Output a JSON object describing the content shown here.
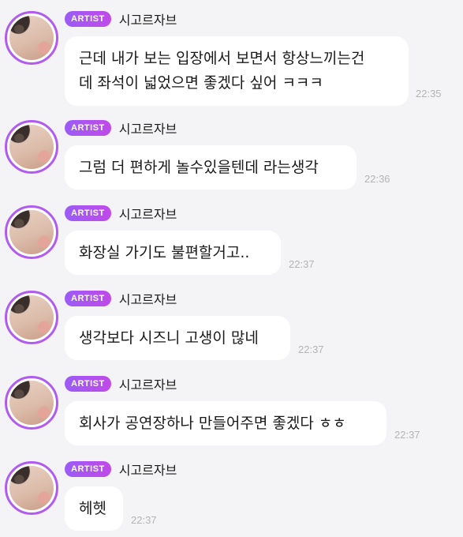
{
  "messages": [
    {
      "badge": "ARTIST",
      "author": "시고르자브",
      "text": "근데 내가 보는 입장에서 보면서 항상느끼는건\n데 좌석이 넓었으면 좋겠다 싶어 ㅋㅋㅋ",
      "time": "22:35"
    },
    {
      "badge": "ARTIST",
      "author": "시고르자브",
      "text": "그럼 더 편하게 놀수있을텐데 라는생각",
      "time": "22:36"
    },
    {
      "badge": "ARTIST",
      "author": "시고르자브",
      "text": "화장실 가기도 불편할거고..",
      "time": "22:37"
    },
    {
      "badge": "ARTIST",
      "author": "시고르자브",
      "text": "생각보다 시즈니 고생이 많네",
      "time": "22:37"
    },
    {
      "badge": "ARTIST",
      "author": "시고르자브",
      "text": "회사가 공연장하나 만들어주면 좋겠다 ㅎㅎ",
      "time": "22:37"
    },
    {
      "badge": "ARTIST",
      "author": "시고르자브",
      "text": "헤헷",
      "time": "22:37"
    }
  ]
}
